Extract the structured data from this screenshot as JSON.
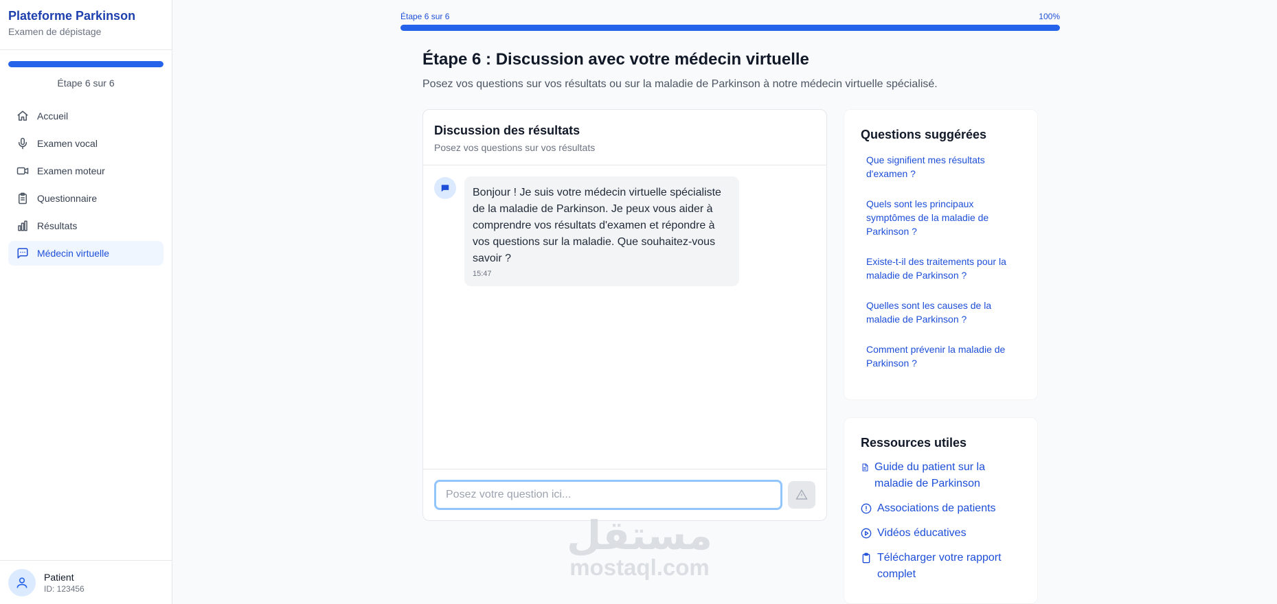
{
  "sidebar": {
    "brand_title": "Plateforme Parkinson",
    "brand_subtitle": "Examen de dépistage",
    "progress": 1.0,
    "step_label": "Étape 6 sur 6",
    "items": [
      {
        "label": "Accueil",
        "icon": "home-icon"
      },
      {
        "label": "Examen vocal",
        "icon": "microphone-icon"
      },
      {
        "label": "Examen moteur",
        "icon": "video-icon"
      },
      {
        "label": "Questionnaire",
        "icon": "clipboard-icon"
      },
      {
        "label": "Résultats",
        "icon": "bar-chart-icon"
      },
      {
        "label": "Médecin virtuelle",
        "icon": "message-icon"
      }
    ],
    "user_name": "Patient",
    "user_id": "ID: 123456"
  },
  "top_progress": {
    "step_label": "Étape 6 sur 6",
    "percent_label": "100%",
    "progress": 1.0
  },
  "main": {
    "title": "Étape 6 : Discussion avec votre médecin virtuelle",
    "description": "Posez vos questions sur vos résultats ou sur la maladie de Parkinson à notre médecin virtuelle spécialisé."
  },
  "chat": {
    "title": "Discussion des résultats",
    "subtitle": "Posez vos questions sur vos résultats",
    "messages": [
      {
        "text": "Bonjour ! Je suis votre médecin virtuelle spécialiste de la maladie de Parkinson. Je peux vous aider à comprendre vos résultats d'examen et répondre à vos questions sur la maladie. Que souhaitez-vous savoir ?",
        "time": "15:47"
      }
    ],
    "input_placeholder": "Posez votre question ici..."
  },
  "suggested": {
    "title": "Questions suggérées",
    "items": [
      "Que signifient mes résultats d'examen ?",
      "Quels sont les principaux symptômes de la maladie de Parkinson ?",
      "Existe-t-il des traitements pour la maladie de Parkinson ?",
      "Quelles sont les causes de la maladie de Parkinson ?",
      "Comment prévenir la maladie de Parkinson ?"
    ]
  },
  "resources": {
    "title": "Ressources utiles",
    "items": [
      {
        "label": "Guide du patient sur la maladie de Parkinson",
        "icon": "document-icon"
      },
      {
        "label": "Associations de patients",
        "icon": "alert-circle-icon"
      },
      {
        "label": "Vidéos éducatives",
        "icon": "play-circle-icon"
      },
      {
        "label": "Télécharger votre rapport complet",
        "icon": "clipboard-icon"
      }
    ]
  },
  "watermark": {
    "arabic": "مستقل",
    "latin": "mostaql.com"
  },
  "colors": {
    "accent": "#2563eb",
    "link": "#1d4ed8",
    "active_bg": "#eff6ff"
  }
}
